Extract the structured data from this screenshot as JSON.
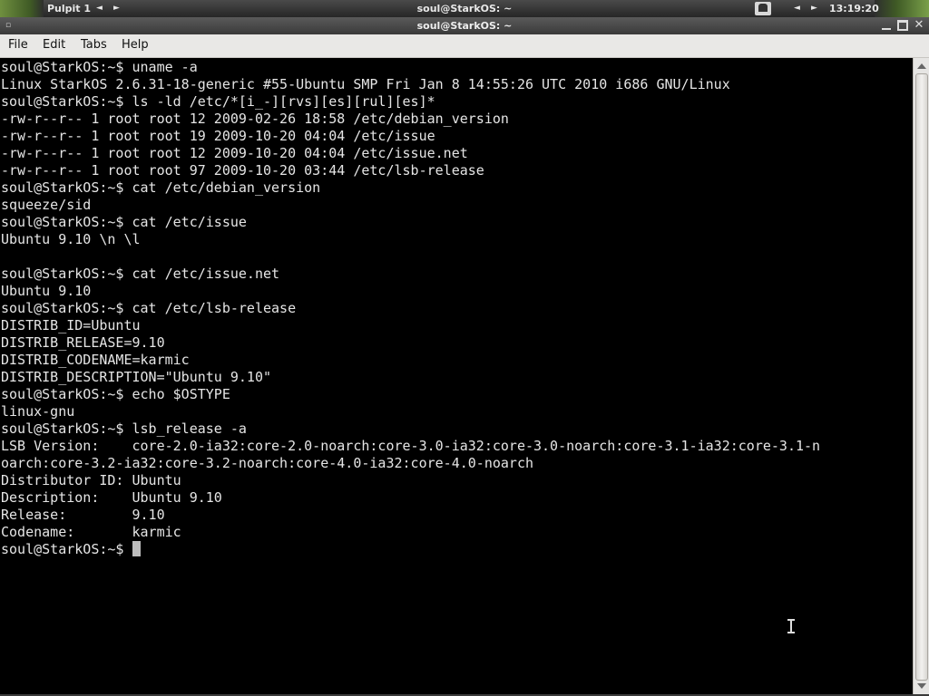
{
  "top_panel": {
    "workspace": "Pulpit 1",
    "prev_glyph": "◄",
    "next_glyph": "►",
    "title": "soul@StarkOS: ~",
    "clock": "13:19:20",
    "app_icon": "window-app-icon"
  },
  "window": {
    "title": "soul@StarkOS: ~",
    "menu_glyph": "▫",
    "close_glyph": "✕"
  },
  "menubar": {
    "file": "File",
    "edit": "Edit",
    "tabs": "Tabs",
    "help": "Help"
  },
  "terminal": {
    "lines": [
      "soul@StarkOS:~$ uname -a",
      "Linux StarkOS 2.6.31-18-generic #55-Ubuntu SMP Fri Jan 8 14:55:26 UTC 2010 i686 GNU/Linux",
      "soul@StarkOS:~$ ls -ld /etc/*[i_-][rvs][es][rul][es]*",
      "-rw-r--r-- 1 root root 12 2009-02-26 18:58 /etc/debian_version",
      "-rw-r--r-- 1 root root 19 2009-10-20 04:04 /etc/issue",
      "-rw-r--r-- 1 root root 12 2009-10-20 04:04 /etc/issue.net",
      "-rw-r--r-- 1 root root 97 2009-10-20 03:44 /etc/lsb-release",
      "soul@StarkOS:~$ cat /etc/debian_version",
      "squeeze/sid",
      "soul@StarkOS:~$ cat /etc/issue",
      "Ubuntu 9.10 \\n \\l",
      "",
      "soul@StarkOS:~$ cat /etc/issue.net",
      "Ubuntu 9.10",
      "soul@StarkOS:~$ cat /etc/lsb-release",
      "DISTRIB_ID=Ubuntu",
      "DISTRIB_RELEASE=9.10",
      "DISTRIB_CODENAME=karmic",
      "DISTRIB_DESCRIPTION=\"Ubuntu 9.10\"",
      "soul@StarkOS:~$ echo $OSTYPE",
      "linux-gnu",
      "soul@StarkOS:~$ lsb_release -a",
      "LSB Version:    core-2.0-ia32:core-2.0-noarch:core-3.0-ia32:core-3.0-noarch:core-3.1-ia32:core-3.1-n",
      "oarch:core-3.2-ia32:core-3.2-noarch:core-4.0-ia32:core-4.0-noarch",
      "Distributor ID: Ubuntu",
      "Description:    Ubuntu 9.10",
      "Release:        9.10",
      "Codename:       karmic"
    ],
    "prompt": "soul@StarkOS:~$ "
  }
}
